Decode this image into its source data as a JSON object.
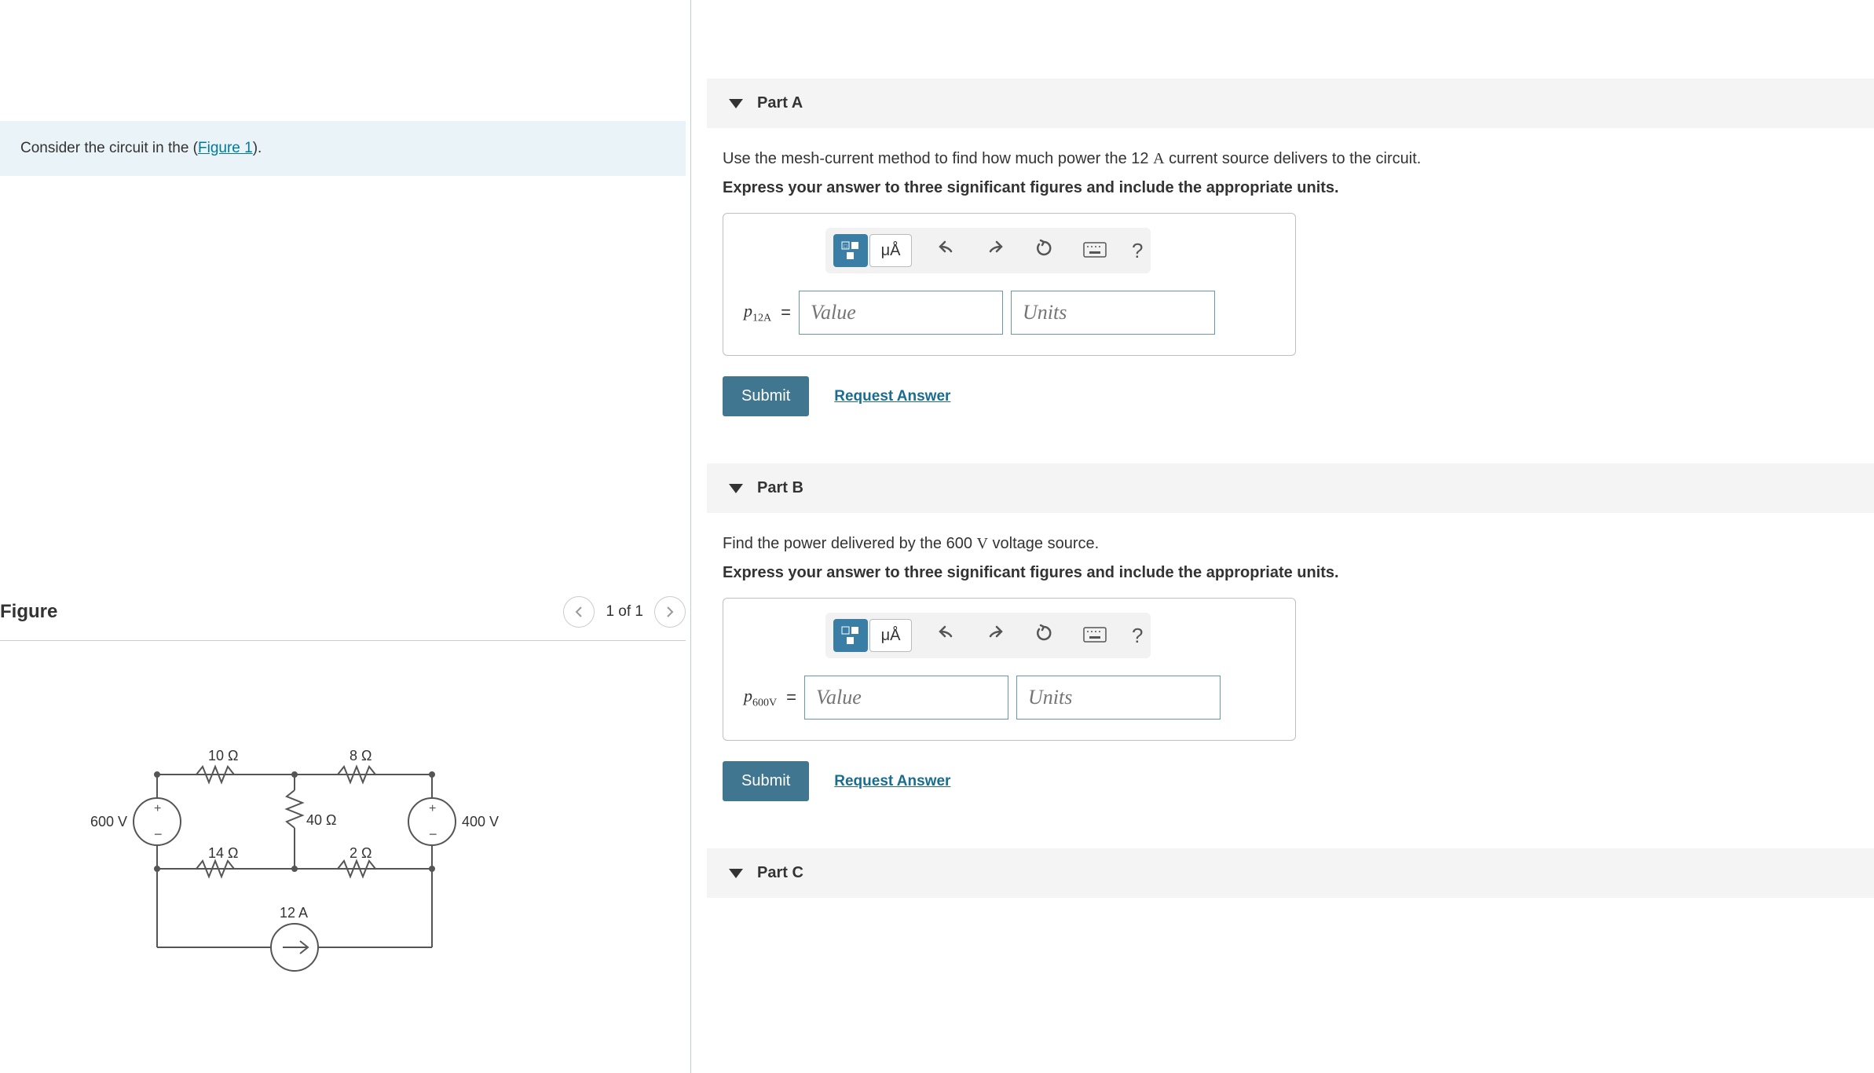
{
  "intro": {
    "prefix": "Consider the circuit in the (",
    "link": "Figure 1",
    "suffix": ")."
  },
  "figure": {
    "title": "Figure",
    "nav_label": "1 of 1",
    "labels": {
      "r10": "10 Ω",
      "r8": "8 Ω",
      "v600": "600 V",
      "r40": "40 Ω",
      "v400": "400 V",
      "r14": "14 Ω",
      "r2": "2 Ω",
      "i12": "12 A"
    }
  },
  "parts": {
    "a": {
      "title": "Part A",
      "prompt_before": "Use the mesh-current method to find how much power the 12 ",
      "prompt_unit": "A",
      "prompt_after": " current source delivers to the circuit.",
      "instruct": "Express your answer to three significant figures and include the appropriate units.",
      "var_base": "p",
      "var_sub": "12A",
      "eq": "=",
      "value_ph": "Value",
      "units_ph": "Units",
      "submit": "Submit",
      "request": "Request Answer"
    },
    "b": {
      "title": "Part B",
      "prompt_before": "Find the power delivered by the 600 ",
      "prompt_unit": "V",
      "prompt_after": " voltage source.",
      "instruct": "Express your answer to three significant figures and include the appropriate units.",
      "var_base": "p",
      "var_sub": "600V",
      "eq": "=",
      "value_ph": "Value",
      "units_ph": "Units",
      "submit": "Submit",
      "request": "Request Answer"
    },
    "c": {
      "title": "Part C"
    }
  },
  "toolbar": {
    "units_btn": "μÅ",
    "help": "?"
  }
}
